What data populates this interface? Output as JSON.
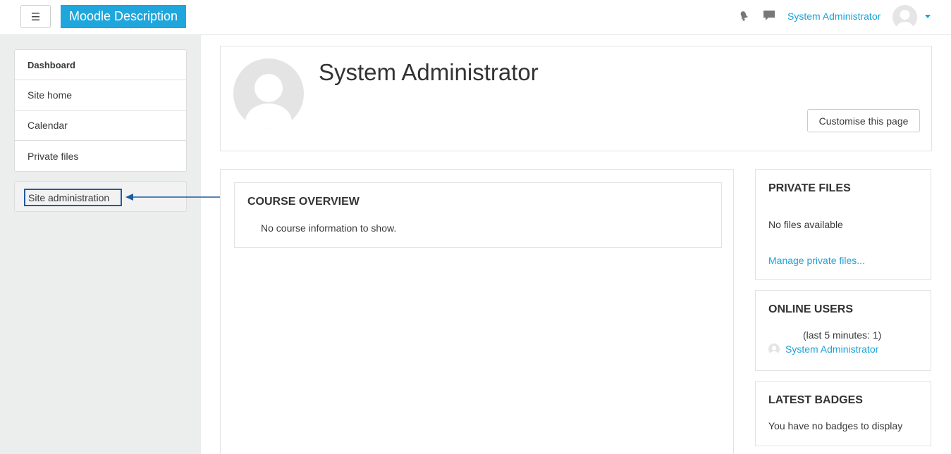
{
  "navbar": {
    "menu_glyph": "☰",
    "brand": "Moodle Description",
    "user_name": "System Administrator",
    "icons": [
      "notification-bell-icon",
      "messages-icon"
    ]
  },
  "drawer": {
    "items": [
      {
        "label": "Dashboard",
        "bold": true
      },
      {
        "label": "Site home"
      },
      {
        "label": "Calendar"
      },
      {
        "label": "Private files"
      }
    ],
    "admin_label": "Site administration"
  },
  "header": {
    "title": "System Administrator",
    "customise_label": "Customise this page"
  },
  "course_overview": {
    "title": "COURSE OVERVIEW",
    "message": "No course information to show."
  },
  "private_files": {
    "title": "PRIVATE FILES",
    "message": "No files available",
    "link": "Manage private files..."
  },
  "online_users": {
    "title": "ONLINE USERS",
    "info": "(last 5 minutes: 1)",
    "user": "System Administrator"
  },
  "latest_badges": {
    "title": "LATEST BADGES",
    "message": "You have no badges to display"
  },
  "colors": {
    "brand": "#1fa6dd",
    "link": "#1ca3d8",
    "annotation": "#1b5da0"
  }
}
